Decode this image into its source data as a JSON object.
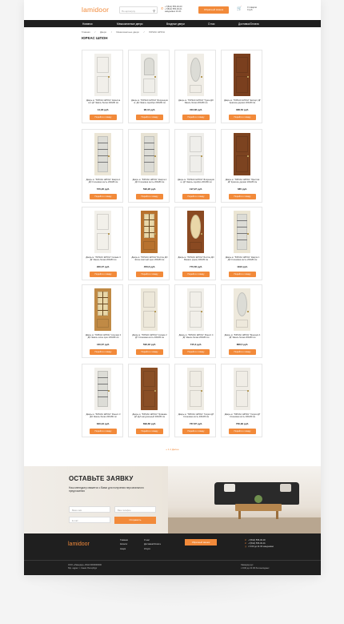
{
  "header": {
    "logo": "lamidoor",
    "search_placeholder": "По артикулу",
    "phones": [
      "+7(812) 555-00-00",
      "+7(812) 555-00-01",
      "ежедневно 10-21"
    ],
    "callback_label": "Обратный звонок",
    "cart_lines": [
      "0 товаров",
      "0 руб."
    ]
  },
  "nav": [
    "Новинки",
    "Межкомнатные двери",
    "Входные двери",
    "О нас",
    "Доставка/Оплата"
  ],
  "breadcrumbs": [
    "Главная",
    "Двери",
    "Межкомнатные двери",
    "ЮРКАС ШПОН"
  ],
  "page_title": "ЮРКАС ШПОН",
  "products": [
    {
      "name": "Дверь м. \"ЮРКАС ШПОН\" Капелла ш-1 ДГ Эмаль белая 200х80 см",
      "price": "14,93 руб.",
      "button": "Перейти к товару",
      "color": "#f1efea",
      "glass": "none"
    },
    {
      "name": "Дверь м. \"ЮРКАС ШПОН\" Флоренция ш. ДО Эмаль серебро 200х80 см",
      "price": "98,44 руб.",
      "button": "Перейти к товару",
      "color": "#efeee9",
      "glass": "arch"
    },
    {
      "name": "Дверь м. \"ЮРКАС ШПОН\" Турин ДО Эмаль белая 200х80 см",
      "price": "403,38 руб.",
      "button": "Перейти к товару",
      "color": "#f0ede6",
      "glass": "oval"
    },
    {
      "name": "Дверь м. \"ЮРКАС ШПОН\" Эксперт ДГ Красное дерево 200х80 см",
      "price": "388,52 руб.",
      "button": "Перейти к товару",
      "color": "#7a3f1e",
      "glass": "none"
    },
    {
      "name": "Дверь м. \"ЮРКАС ШПОН\" Кварта-1 ДО Слоновая кость 200х80 см",
      "price": "570,26 руб.",
      "button": "Перейти к товару",
      "color": "#ece6d6",
      "glass": "lines"
    },
    {
      "name": "Дверь м. \"ЮРКАС ШПОН\" Кварта-1 ДО Слоновая кость 200х80 см",
      "price": "590,26 руб.",
      "button": "Перейти к товару",
      "color": "#e8e3d4",
      "glass": "lines"
    },
    {
      "name": "Дверь м. \"ЮРКАС ШПОН\" Флоренция ш. ДГ Эмаль серебро 200х80 см",
      "price": "197,97 руб.",
      "button": "Перейти к товару",
      "color": "#efeeea",
      "glass": "none"
    },
    {
      "name": "Дверь м. \"ЮРКАС ШПОН\" Престиж ДГ Красное дерево 200х80 см",
      "price": "685 руб.",
      "button": "Перейти к товару",
      "color": "#7c4320",
      "glass": "none"
    },
    {
      "name": "Дверь м. \"ЮРКАС ШПОН\" Сальве 3 ДГ Эмаль белая 200х80 см",
      "price": "900,07 руб.",
      "button": "Перейти к товару",
      "color": "#f2f0ea",
      "glass": "none"
    },
    {
      "name": "Дверь м. \"ЮРКАС ШПОН\" Бостон ДО Шпон светлый орех 200х80 см",
      "price": "456,6 руб.",
      "button": "Перейти к товару",
      "color": "#b8722e",
      "glass": "grid"
    },
    {
      "name": "Дверь м. \"ЮРКАС ШПОН\" Бостон ДО Макаси (орех) 200х80 см",
      "price": "770,56 руб.",
      "button": "Перейти к товару",
      "color": "#8a4a22",
      "glass": "oval"
    },
    {
      "name": "Дверь м. \"ЮРКАС ШПОН\" Кварта 1 ДО Слоновая кость 200х80 см",
      "price": "1190 руб.",
      "button": "Перейти к товару",
      "color": "#ebe5d3",
      "glass": "lines"
    },
    {
      "name": "Дверь м. \"ЮРКАС ШПОН\" Альтаир 2 ДО Эмаль шпон орех 200х80 см",
      "price": "440,67 руб.",
      "button": "Перейти к товару",
      "color": "#c08a45",
      "glass": "grid"
    },
    {
      "name": "Дверь м. \"ЮРКАС ШПОН\" Сальве 2 ДГ Слоновая кость 200х80 см",
      "price": "590,02 руб.",
      "button": "Перейти к товару",
      "color": "#ede8da",
      "glass": "none"
    },
    {
      "name": "Дверь м. \"ЮРКАС ШПОН\" Ренесс 4 ДГ Эмаль белая 200х80 см",
      "price": "745,3 руб.",
      "button": "Перейти к товару",
      "color": "#f1efe9",
      "glass": "none"
    },
    {
      "name": "Дверь м. \"ЮРКАС ШПОН\" Венеция 4 ДГ Эмаль белая 200х80 см",
      "price": "888,5 руб.",
      "button": "Перейти к товару",
      "color": "#eee9dc",
      "glass": "oval"
    },
    {
      "name": "Дверь м. \"ЮРКАС ШПОН\" Ренесс 3 ДО Эмаль белая 200х80 см",
      "price": "840,94 руб.",
      "button": "Перейти к товару",
      "color": "#f1efea",
      "glass": "lines"
    },
    {
      "name": "Дверь м. \"ЮРКАС ШПОН\" Примава ДГ Дуб натуральный 200х80 см",
      "price": "899,66 руб.",
      "button": "Перейти к товару",
      "color": "#8a4f26",
      "glass": "none"
    },
    {
      "name": "Дверь м. \"ЮРКАС ШПОН\" Глория ДГ Слоновая кость 200х80 см",
      "price": "767,87 руб.",
      "button": "Перейти к товару",
      "color": "#efece4",
      "glass": "none"
    },
    {
      "name": "Дверь м. \"ЮРКАС ШПОН\" Глория ДГ Слоновая кость 200х80 см",
      "price": "760,99 руб.",
      "button": "Перейти к товару",
      "color": "#f0ede6",
      "glass": "none"
    }
  ],
  "pagination": "« 1 2 Далее",
  "request": {
    "title": "ОСТАВЬТЕ ЗАЯВКУ",
    "subtitle": "Наш менеджер свяжется с Вами для получения персонального предложения",
    "name_placeholder": "Ваше имя",
    "phone_placeholder": "Ваш телефон",
    "email_placeholder": "E-mail",
    "send_label": "Отправить"
  },
  "footer": {
    "logo": "lamidoor",
    "col1": [
      "Главная",
      "Каталог",
      "Акции"
    ],
    "col2": [
      "О нас",
      "Доставка/Оплата",
      "Услуги"
    ],
    "callback_label": "Обратный звонок",
    "contacts": [
      "+7(812) 555-00-00",
      "+7(812) 555-00-01",
      "с 9:00 до 21:00 ежедневно"
    ],
    "legal": [
      "ООО «Ламидор» ИНН 0000000000",
      "Юр. адрес: г. Санкт-Петербург"
    ],
    "legal2": [
      "Ламидор.рус",
      "с 9:00 до 21:00 без выходных"
    ]
  },
  "colors": {
    "accent": "#f28a3a",
    "dark": "#1f1f1f"
  }
}
